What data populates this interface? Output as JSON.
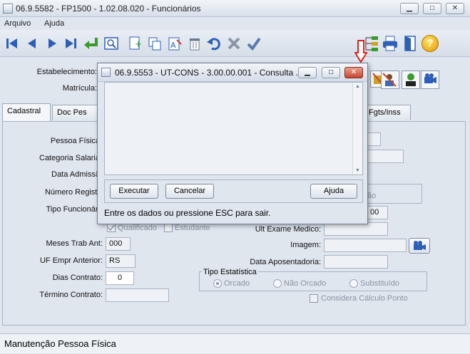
{
  "window": {
    "title": "06.9.5582 - FP1500 - 1.02.08.020 - Funcionários",
    "minimize_glyph": "▁",
    "maximize_glyph": "□",
    "close_glyph": "✕"
  },
  "menu": {
    "items": [
      "Arquivo",
      "Ajuda"
    ]
  },
  "toolbar": {
    "icons": [
      "first-icon",
      "prev-icon",
      "next-icon",
      "last-icon",
      "goto-icon",
      "zoom-icon",
      "new-icon",
      "copy-icon",
      "edit-icon",
      "delete-icon",
      "undo-icon",
      "cancel-icon",
      "confirm-icon",
      "tree-icon",
      "print-icon",
      "exit-icon",
      "help-icon"
    ],
    "help_glyph": "?"
  },
  "header": {
    "estabelecimento_label": "Estabelecimento:",
    "matricula_label": "Matrícula:"
  },
  "tabs": [
    {
      "label": "Cadastral",
      "active": true
    },
    {
      "label": "Doc Pes",
      "active": false
    },
    {
      "label": "Fgts/Inss",
      "active": false
    }
  ],
  "form": {
    "pessoa_fisica_label": "Pessoa Física",
    "categoria_salarial_label": "Categoria Salaria",
    "data_admissao_label": "Data Admissã",
    "numero_registro_label": "Número Registr",
    "tipo_funcionario_label": "Tipo Funcionári",
    "qualificado_label": "Qualificado",
    "estudante_label": "Estudante",
    "ult_exame_label": "Ult Exame Medico:",
    "meses_trab_label": "Meses Trab Ant:",
    "meses_trab_value": "000",
    "imagem_label": "Imagem:",
    "uf_empr_label": "UF Empr Anterior:",
    "uf_empr_value": "RS",
    "data_aposent_label": "Data Aposentadoria:",
    "dias_contrato_label": "Dias Contrato:",
    "dias_contrato_value": "0",
    "termino_contrato_label": "Término Contrato:",
    "obscured_field_value": "00",
    "obscured_partial_text": "ão",
    "tipo_estatistica_label": "Tipo Estatística",
    "orcado_label": "Orcado",
    "nao_orcado_label": "Não Orcado",
    "substituido_label": "Substituído",
    "considera_calculo_label": "Considera Cálculo Ponto"
  },
  "dialog": {
    "title": "06.9.5553 - UT-CONS - 3.00.00.001 - Consulta ...",
    "executar_label": "Executar",
    "cancelar_label": "Cancelar",
    "ajuda_label": "Ajuda",
    "message": "Entre os dados ou pressione ESC para sair.",
    "scroll_up_glyph": "▲",
    "scroll_down_glyph": "▼"
  },
  "status": {
    "text": "Manutenção Pessoa Física"
  },
  "colors": {
    "close_red": "#c6452c",
    "annotation_arrow": "#e02020",
    "toolbar_blue": "#2d5fb8"
  }
}
